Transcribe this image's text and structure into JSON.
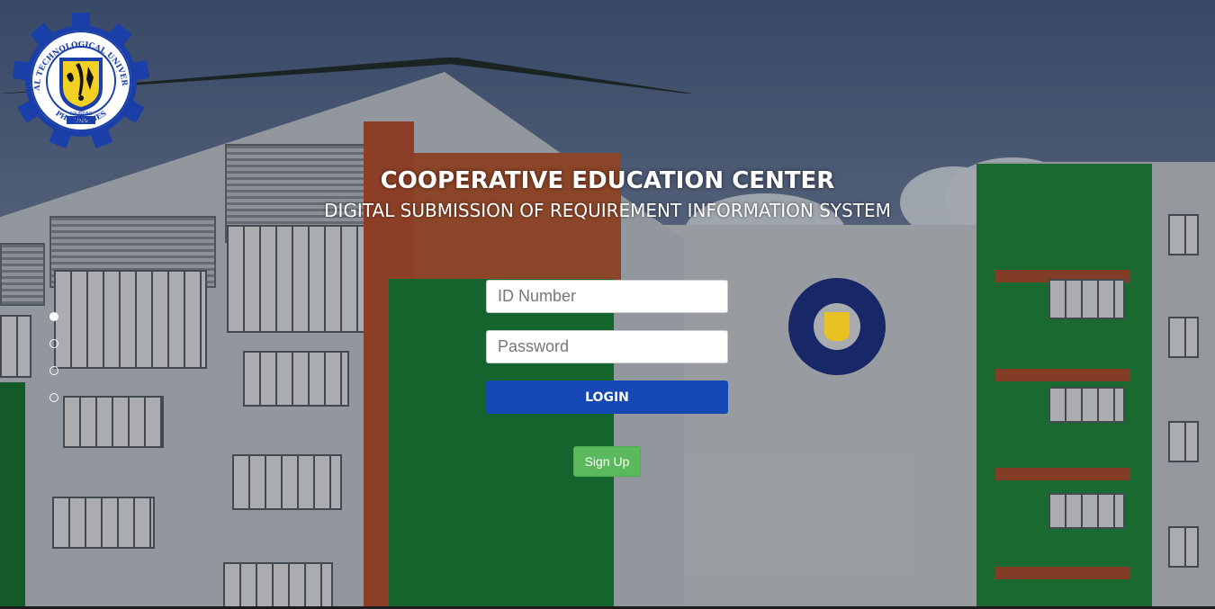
{
  "header": {
    "title": "COOPERATIVE EDUCATION CENTER",
    "subtitle": "DIGITAL SUBMISSION OF REQUIREMENT INFORMATION SYSTEM"
  },
  "logo": {
    "icon": "university-seal-icon",
    "ring_text": "RIZAL TECHNOLOGICAL UNIVERSITY",
    "bottom_text": "PHILIPPINES",
    "founded_text": "FOUNDED",
    "founded_year": "1969"
  },
  "carousel": {
    "slides": [
      {
        "active": true
      },
      {
        "active": false
      },
      {
        "active": false
      },
      {
        "active": false
      }
    ]
  },
  "login_form": {
    "id_placeholder": "ID Number",
    "id_value": "",
    "password_placeholder": "Password",
    "password_value": "",
    "login_label": "LOGIN",
    "signup_label": "Sign Up"
  },
  "colors": {
    "login_button": "#1648b3",
    "signup_button": "#5cb85c",
    "seal_blue": "#1b3fa8",
    "seal_yellow": "#f2d024"
  }
}
